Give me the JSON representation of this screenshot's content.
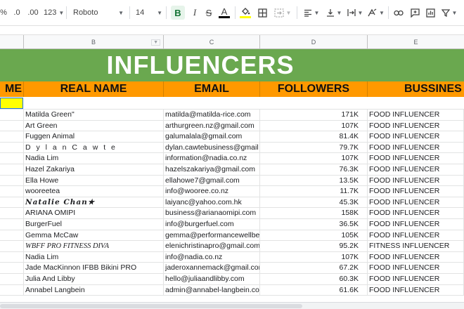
{
  "toolbar": {
    "percent": "%",
    "dec_decrease": ".0",
    "dec_increase": ".00",
    "format_more": "123",
    "font_family": "Roboto",
    "font_size": "14",
    "bold": "B",
    "italic": "I",
    "strike": "S",
    "text_color": "A"
  },
  "columns": [
    "B",
    "C",
    "D",
    "E"
  ],
  "title": "INFLUENCERS",
  "headers": {
    "a": "ME",
    "b": "REAL NAME",
    "c": "EMAIL",
    "d": "FOLLOWERS",
    "e": "BUSSINES"
  },
  "rows": [
    {
      "name": "Matilda Green\"",
      "email": "matilda@matilda-rice.com",
      "followers": "171K",
      "business": "FOOD INFLUENCER"
    },
    {
      "name": "Art Green",
      "email": "arthurgreen.nz@gmail.com",
      "followers": "107K",
      "business": "FOOD INFLUENCER"
    },
    {
      "name": "Fuggen Animal",
      "email": "galumalala@gmail.com",
      "followers": "81.4K",
      "business": "FOOD INFLUENCER"
    },
    {
      "name": "D y l a n C a w t e",
      "email": "dylan.cawtebusiness@gmail",
      "followers": "79.7K",
      "business": "FOOD INFLUENCER"
    },
    {
      "name": "Nadia Lim",
      "email": "information@nadia.co.nz",
      "followers": "107K",
      "business": "FOOD INFLUENCER"
    },
    {
      "name": "Hazel Zakariya",
      "email": "hazelszakariya@gmail.com",
      "followers": "76.3K",
      "business": "FOOD INFLUENCER"
    },
    {
      "name": "Ella Howe",
      "email": "ellahowe7@gmail.com",
      "followers": "13.5K",
      "business": "FOOD INFLUENCER"
    },
    {
      "name": "wooreetea",
      "email": "info@wooree.co.nz",
      "followers": "11.7K",
      "business": "FOOD INFLUENCER"
    },
    {
      "name": "Natalie Chan★",
      "email": "laiyanc@yahoo.com.hk",
      "followers": "45.3K",
      "business": "FOOD INFLUENCER"
    },
    {
      "name": "ARIANA OMIPI",
      "email": "business@arianaomipi.com",
      "followers": "158K",
      "business": "FOOD INFLUENCER"
    },
    {
      "name": "BurgerFuel",
      "email": "info@burgerfuel.com",
      "followers": "36.5K",
      "business": "FOOD INFLUENCER"
    },
    {
      "name": "Gemma McCaw",
      "email": "gemma@performancewellbe",
      "followers": "105K",
      "business": "FOOD INFLUENCER"
    },
    {
      "name": "WBFF PRO FITNESS DIVA",
      "email": "elenichristinapro@gmail.com",
      "followers": "95.2K",
      "business": "FITNESS INFLUENCER"
    },
    {
      "name": "Nadia Lim",
      "email": "info@nadia.co.nz",
      "followers": "107K",
      "business": "FOOD INFLUENCER"
    },
    {
      "name": "Jade MacKinnon IFBB Bikini PRO",
      "email": "jaderoxannemack@gmail.com",
      "followers": "67.2K",
      "business": "FOOD INFLUENCER"
    },
    {
      "name": "Julia And Libby",
      "email": "hello@juliaandlibby.com",
      "followers": "60.3K",
      "business": "FOOD INFLUENCER"
    },
    {
      "name": "Annabel Langbein",
      "email": "admin@annabel-langbein.co",
      "followers": "61.6K",
      "business": "FOOD INFLUENCER"
    }
  ],
  "colors": {
    "title_bg": "#6aa84f",
    "header_bg": "#ff9900",
    "selected_cell": "#ffff00"
  }
}
